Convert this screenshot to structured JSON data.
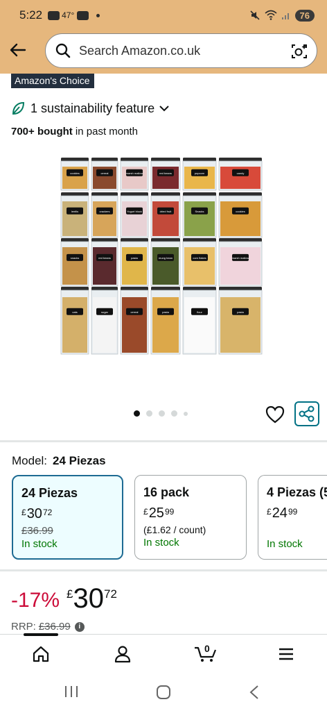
{
  "status_bar": {
    "time": "5:22",
    "temperature": "47°",
    "battery": "76"
  },
  "header": {
    "search_placeholder": "Search Amazon.co.uk"
  },
  "badge": {
    "label": "Amazon's Choice"
  },
  "sustainability": {
    "text": "1 sustainability feature"
  },
  "social_proof": {
    "bold": "700+ bought",
    "rest": " in past month"
  },
  "product_image": {
    "rows": [
      [
        "cookies",
        "cereal",
        "marsh mallow",
        "red beans",
        "popcorn",
        "candy"
      ],
      [
        "lentils",
        "crackers",
        "Yogurt block",
        "dried fruit",
        "Snacks",
        "cookies"
      ],
      [
        "snacks",
        "red beans",
        "pasta",
        "mung bean",
        "corn flakes",
        "marsh mallow"
      ],
      [
        "oats",
        "sugar",
        "cereal",
        "pasta",
        "flour",
        "pasta"
      ]
    ]
  },
  "carousel": {
    "count": 5,
    "active": 0
  },
  "model": {
    "label": "Model:",
    "value": "24 Piezas"
  },
  "variants": [
    {
      "title": "24 Piezas",
      "currency": "£",
      "whole": "30",
      "fraction": "72",
      "rrp": "£36.99",
      "unit": "",
      "stock": "In stock"
    },
    {
      "title": "16 pack",
      "currency": "£",
      "whole": "25",
      "fraction": "99",
      "rrp": "",
      "unit": "(£1.62 / count)",
      "stock": "In stock"
    },
    {
      "title": "4 Piezas (5",
      "currency": "£",
      "whole": "24",
      "fraction": "99",
      "rrp": "",
      "unit": "",
      "stock": "In stock"
    }
  ],
  "price": {
    "discount": "-17%",
    "currency": "£",
    "whole": "30",
    "fraction": "72"
  },
  "rrp": {
    "label": "RRP:",
    "value": "£36.99",
    "info": "i"
  },
  "bottom_nav": {
    "cart_count": "0"
  },
  "colors": {
    "header_bg": "#e6b77d",
    "teal": "#007185",
    "discount_red": "#cc0c39",
    "stock_green": "#007600"
  }
}
